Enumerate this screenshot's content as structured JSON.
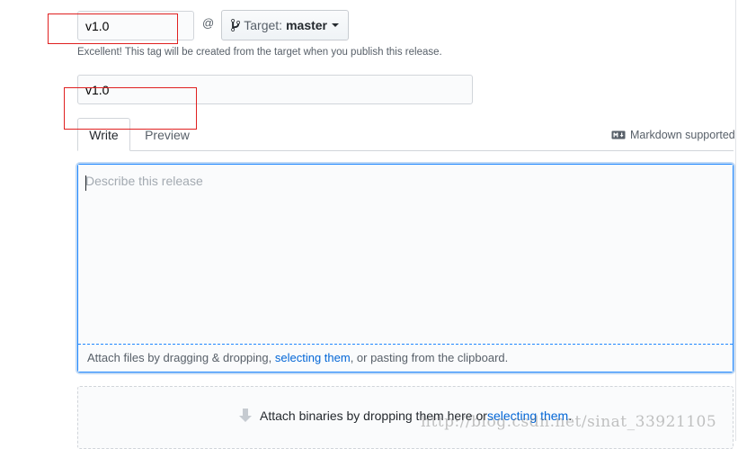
{
  "tag": {
    "value": "v1.0"
  },
  "at_symbol": "@",
  "target": {
    "label": "Target:",
    "branch": "master",
    "icon": "git-branch-icon"
  },
  "hint": "Excellent! This tag will be created from the target when you publish this release.",
  "release_title": {
    "value": "v1.0"
  },
  "tabs": [
    {
      "label": "Write",
      "active": true
    },
    {
      "label": "Preview",
      "active": false
    }
  ],
  "markdown": {
    "label": "Markdown supported",
    "icon": "markdown-icon"
  },
  "editor": {
    "placeholder": "Describe this release"
  },
  "attach": {
    "before": "Attach files by dragging & dropping, ",
    "link": "selecting them",
    "after": ", or pasting from the clipboard."
  },
  "binaries": {
    "before": "Attach binaries by dropping them here or ",
    "link": "selecting them",
    "after": ".",
    "icon": "download-arrow-icon"
  },
  "watermark": "http://blog.csdn.net/sinat_33921105",
  "colors": {
    "accent": "#0366d6",
    "focus_border": "#2188ff",
    "annotation": "#e02020"
  }
}
